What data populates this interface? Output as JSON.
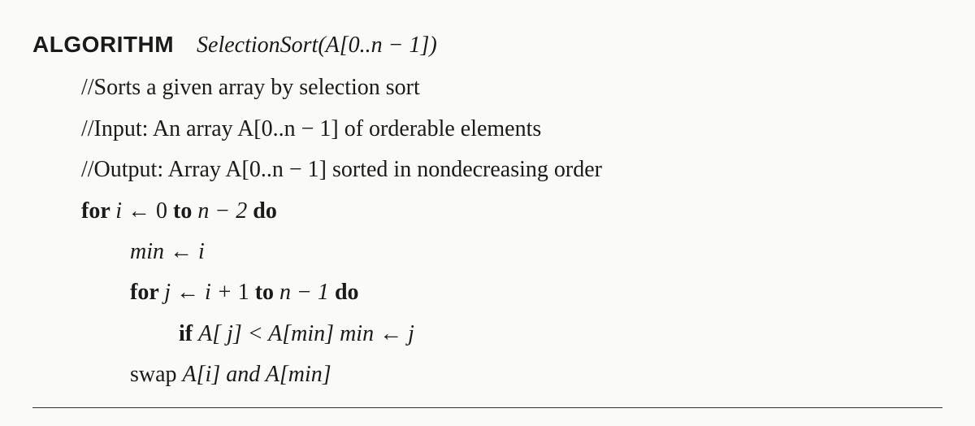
{
  "header": {
    "keyword": "ALGORITHM",
    "name": "SelectionSort",
    "arg": "(A[0..n − 1])"
  },
  "comments": {
    "desc": "//Sorts a given array by selection sort",
    "input": "//Input: An array A[0..n − 1] of orderable elements",
    "output": "//Output: Array A[0..n − 1] sorted in nondecreasing order"
  },
  "code": {
    "for_outer": {
      "kw_for": "for ",
      "var": "i ← ",
      "start": "0 ",
      "kw_to": "to ",
      "end": "n − 2 ",
      "kw_do": "do"
    },
    "min_assign": "min ← i",
    "for_inner": {
      "kw_for": "for ",
      "var": "j ← i + ",
      "start": "1 ",
      "kw_to": "to ",
      "end": "n − 1 ",
      "kw_do": "do"
    },
    "if_line": {
      "kw_if": "if ",
      "cond": "A[ j] < A[min]   min ← j"
    },
    "swap": {
      "word": "swap ",
      "expr": "A[i] and A[min]"
    }
  }
}
